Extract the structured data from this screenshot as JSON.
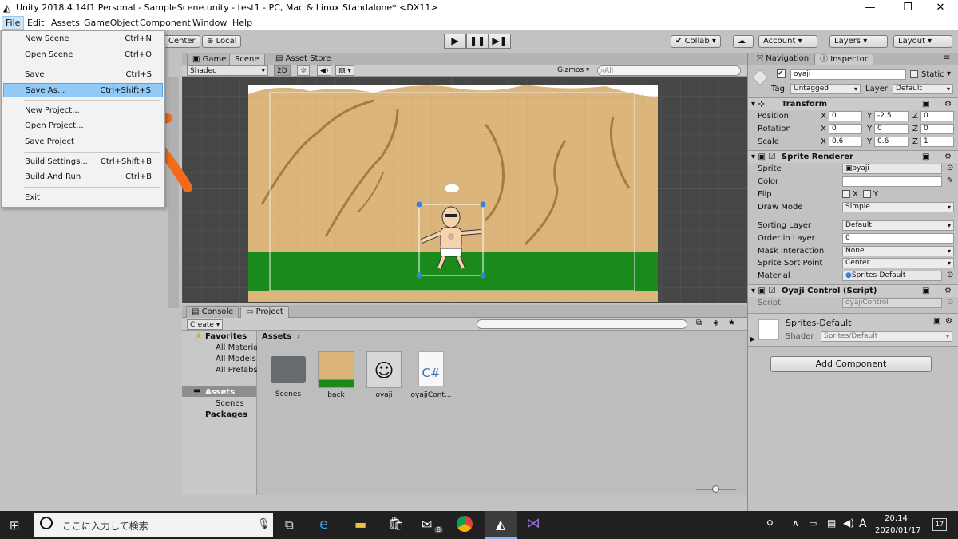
{
  "window": {
    "title": "Unity 2018.4.14f1 Personal - SampleScene.unity - test1 - PC, Mac & Linux Standalone* <DX11>",
    "minimize": "—",
    "maximize": "❐",
    "close": "✕"
  },
  "menubar": [
    "File",
    "Edit",
    "Assets",
    "GameObject",
    "Component",
    "Window",
    "Help"
  ],
  "file_menu": [
    {
      "label": "New Scene",
      "shortcut": "Ctrl+N"
    },
    {
      "label": "Open Scene",
      "shortcut": "Ctrl+O"
    },
    {
      "label": "Save",
      "shortcut": "Ctrl+S"
    },
    {
      "label": "Save As...",
      "shortcut": "Ctrl+Shift+S"
    },
    {
      "label": "New Project...",
      "shortcut": ""
    },
    {
      "label": "Open Project...",
      "shortcut": ""
    },
    {
      "label": "Save Project",
      "shortcut": ""
    },
    {
      "label": "Build Settings...",
      "shortcut": "Ctrl+Shift+B"
    },
    {
      "label": "Build And Run",
      "shortcut": "Ctrl+B"
    },
    {
      "label": "Exit",
      "shortcut": ""
    }
  ],
  "toolbar": {
    "center": "Center",
    "local": "Local",
    "collab": "Collab",
    "account": "Account",
    "layers": "Layers",
    "layout": "Layout"
  },
  "scene_tabs": {
    "game": "Game",
    "scene": "Scene",
    "asset_store": "Asset Store",
    "shaded": "Shaded",
    "mode2d": "2D",
    "gizmos": "Gizmos",
    "search_placeholder": "All"
  },
  "bottom_tabs": {
    "console": "Console",
    "project": "Project",
    "create": "Create"
  },
  "project": {
    "favorites": "Favorites",
    "fav_items": [
      "All Materia",
      "All Models",
      "All Prefabs"
    ],
    "assets": "Assets",
    "asset_children": [
      "Scenes"
    ],
    "packages": "Packages",
    "breadcrumb": "Assets",
    "items": [
      "Scenes",
      "back",
      "oyaji",
      "oyajiCont..."
    ]
  },
  "inspector": {
    "nav_tab": "Navigation",
    "insp_tab": "Inspector",
    "object_name": "oyaji",
    "static": "Static",
    "tag_label": "Tag",
    "tag": "Untagged",
    "layer_label": "Layer",
    "layer": "Default",
    "transform": "Transform",
    "rows": [
      {
        "label": "Position",
        "x": "0",
        "y": "-2.5",
        "z": "0"
      },
      {
        "label": "Rotation",
        "x": "0",
        "y": "0",
        "z": "0"
      },
      {
        "label": "Scale",
        "x": "0.6",
        "y": "0.6",
        "z": "1"
      }
    ],
    "axes": [
      "X",
      "Y",
      "Z"
    ],
    "sprite_renderer": "Sprite Renderer",
    "sr_labels": [
      "Sprite",
      "Color",
      "Flip",
      "Draw Mode",
      "Sorting Layer",
      "Order in Layer",
      "Mask Interaction",
      "Sprite Sort Point",
      "Material"
    ],
    "sprite": "oyaji",
    "flip_x": "X",
    "flip_y": "Y",
    "draw_mode": "Simple",
    "sorting_layer": "Default",
    "order": "0",
    "mask": "None",
    "sort_point": "Center",
    "material": "Sprites-Default",
    "script_comp": "Oyaji Control (Script)",
    "script_label": "Script",
    "script": "oyajiControl",
    "mat_name": "Sprites-Default",
    "shader_label": "Shader",
    "shader": "Sprites/Default",
    "add_component": "Add Component"
  },
  "taskbar": {
    "search": "ここに入力して検索",
    "time": "20:14",
    "date": "2020/01/17",
    "ime": "A",
    "mail_badge": "8",
    "notif": "17"
  },
  "colors": {
    "accent_orange": "#f26b1d",
    "ground": "#1a8a1a",
    "sand": "#dcb57c",
    "menu_highlight": "#91c9f7"
  }
}
